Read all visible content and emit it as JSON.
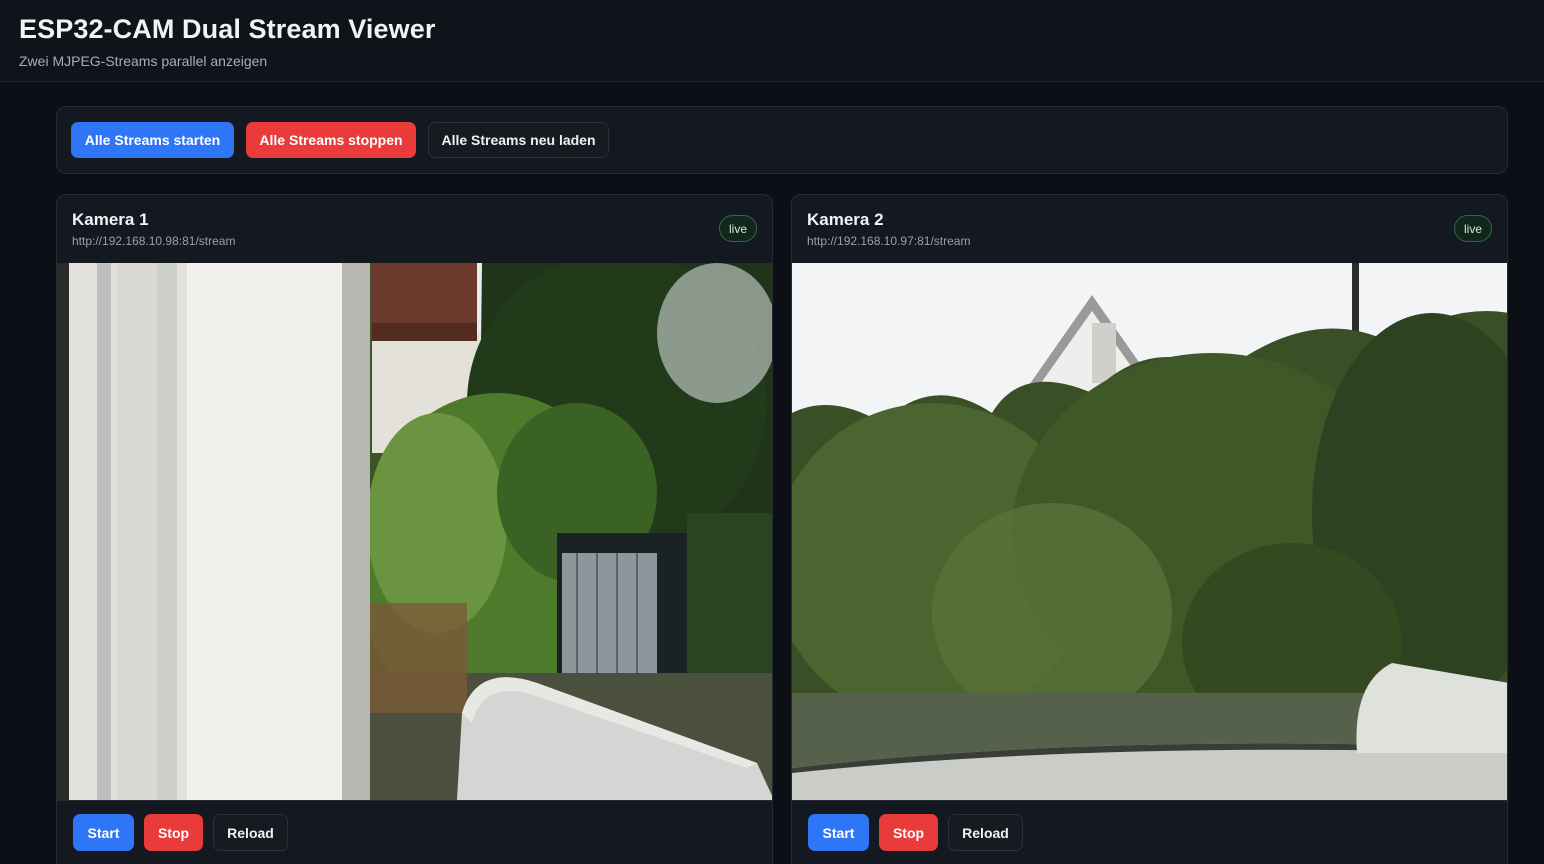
{
  "header": {
    "title": "ESP32-CAM Dual Stream Viewer",
    "subtitle": "Zwei MJPEG-Streams parallel anzeigen"
  },
  "controls": {
    "start_all_label": "Alle Streams starten",
    "stop_all_label": "Alle Streams stoppen",
    "reload_all_label": "Alle Streams neu laden"
  },
  "cameras": [
    {
      "title": "Kamera 1",
      "url": "http://192.168.10.98:81/stream",
      "status": "live",
      "start_label": "Start",
      "stop_label": "Stop",
      "reload_label": "Reload"
    },
    {
      "title": "Kamera 2",
      "url": "http://192.168.10.97:81/stream",
      "status": "live",
      "start_label": "Start",
      "stop_label": "Stop",
      "reload_label": "Reload"
    }
  ],
  "colors": {
    "primary": "#2f76f6",
    "danger": "#ea3b3b",
    "live_badge": "#2f6a46",
    "background": "#0c0f15"
  }
}
